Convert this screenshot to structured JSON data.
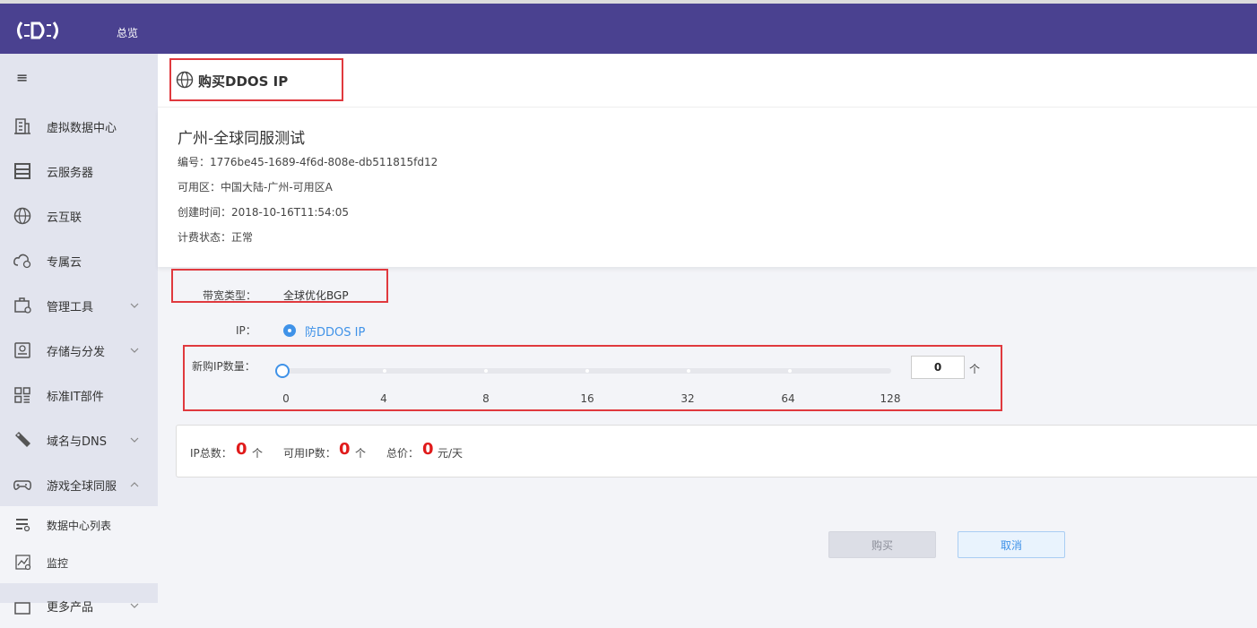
{
  "topbar": {
    "logo_icon": "cds-logo",
    "nav_item": "总览",
    "bg_color": "#4a4190"
  },
  "sidebar": {
    "toggle_icon": "hamburger-icon",
    "items": [
      {
        "label": "虚拟数据中心",
        "icon": "building-icon",
        "has_chevron": false
      },
      {
        "label": "云服务器",
        "icon": "server-icon",
        "has_chevron": false
      },
      {
        "label": "云互联",
        "icon": "globe-icon",
        "has_chevron": false
      },
      {
        "label": "专属云",
        "icon": "cloud-icon",
        "has_chevron": false
      },
      {
        "label": "管理工具",
        "icon": "toolbox-icon",
        "has_chevron": true
      },
      {
        "label": "存储与分发",
        "icon": "storage-icon",
        "has_chevron": true
      },
      {
        "label": "标准IT部件",
        "icon": "grid-icon",
        "has_chevron": false
      },
      {
        "label": "域名与DNS",
        "icon": "tag-icon",
        "has_chevron": true
      },
      {
        "label": "游戏全球同服",
        "icon": "gamepad-icon",
        "has_chevron": true
      },
      {
        "label": "更多产品",
        "icon": "more-icon",
        "has_chevron": true
      }
    ],
    "subitems": [
      {
        "label": "数据中心列表",
        "icon": "list-icon"
      },
      {
        "label": "监控",
        "icon": "monitor-chart-icon"
      }
    ]
  },
  "header": {
    "title": "购买DDOS IP",
    "icon": "globe-icon"
  },
  "info": {
    "name": "广州-全球同服测试",
    "id_line": "编号：1776be45-1689-4f6d-808e-db511815fd12",
    "zone_line": "可用区：中国大陆-广州-可用区A",
    "created_line": "创建时间：2018-10-16T11:54:05",
    "billing_line": "计费状态：正常"
  },
  "form": {
    "bandwidth_label": "带宽类型：",
    "bandwidth_value": "全球优化BGP",
    "ip_label": "IP：",
    "ip_option": "防DDOS IP",
    "qty_label": "新购IP数量：",
    "qty_value": "0",
    "qty_unit": "个",
    "slider_ticks": [
      "0",
      "4",
      "8",
      "16",
      "32",
      "64",
      "128"
    ],
    "slider_selected_index": 0
  },
  "summary": {
    "total_label": "IP总数：",
    "total_value": "0",
    "total_unit": "个",
    "avail_label": "可用IP数：",
    "avail_value": "0",
    "avail_unit": "个",
    "price_label": "总价：",
    "price_value": "0",
    "price_unit": "元/天"
  },
  "buttons": {
    "buy": "购买",
    "cancel": "取消"
  }
}
